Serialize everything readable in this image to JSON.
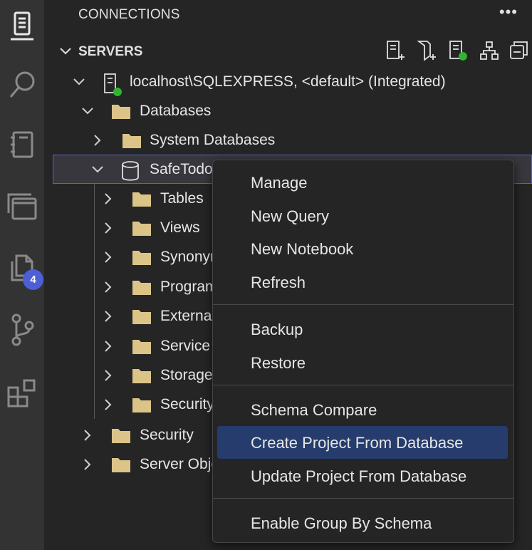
{
  "activity_bar": {
    "items": [
      {
        "name": "connections-icon",
        "active": true
      },
      {
        "name": "search-icon"
      },
      {
        "name": "notebooks-icon"
      },
      {
        "name": "explorer-icon"
      },
      {
        "name": "files-icon"
      },
      {
        "name": "source-control-icon"
      },
      {
        "name": "extensions-icon"
      }
    ],
    "badge": "4"
  },
  "header": {
    "title": "CONNECTIONS",
    "more": "•••"
  },
  "section": {
    "label": "SERVERS",
    "tools": [
      "new-connection-icon",
      "new-server-group-icon",
      "active-connections-icon",
      "tree-icon",
      "collapse-all-icon"
    ]
  },
  "tree": [
    {
      "label": "localhost\\SQLEXPRESS, <default> (Integrated)",
      "kind": "server"
    },
    {
      "label": "Databases",
      "kind": "folder"
    },
    {
      "label": "System Databases",
      "kind": "folder"
    },
    {
      "label": "SafeTodo",
      "kind": "database"
    },
    {
      "label": "Tables",
      "kind": "folder"
    },
    {
      "label": "Views",
      "kind": "folder"
    },
    {
      "label": "Synonyms",
      "kind": "folder"
    },
    {
      "label": "Programmability",
      "kind": "folder"
    },
    {
      "label": "External Resources",
      "kind": "folder"
    },
    {
      "label": "Service Broker",
      "kind": "folder"
    },
    {
      "label": "Storage",
      "kind": "folder"
    },
    {
      "label": "Security",
      "kind": "folder"
    },
    {
      "label": "Security",
      "kind": "folder"
    },
    {
      "label": "Server Objects",
      "kind": "folder"
    }
  ],
  "context_menu": {
    "items": [
      "Manage",
      "New Query",
      "New Notebook",
      "Refresh",
      "Backup",
      "Restore",
      "Schema Compare",
      "Create Project From Database",
      "Update Project From Database",
      "Enable Group By Schema"
    ],
    "highlighted": "Create Project From Database"
  },
  "colors": {
    "accent": "#4d5fd6",
    "connected": "#2fb52f",
    "folder": "#dcc488",
    "menu_highlight": "#263c6c"
  }
}
